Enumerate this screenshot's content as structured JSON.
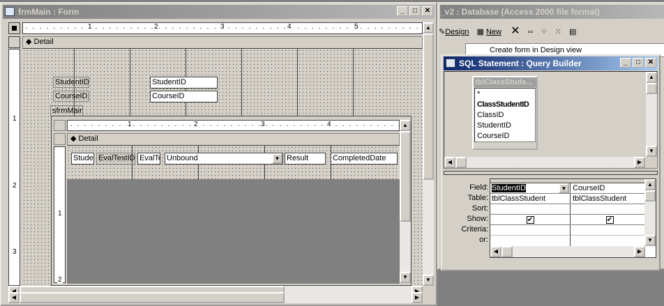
{
  "form_window": {
    "title": "frmMain : Form",
    "ruler": [
      "1",
      "2",
      "3",
      "4",
      "5"
    ],
    "detail_label": "Detail",
    "labels": {
      "student": "StudentID",
      "course": "CourseID:",
      "subform": "sfrmMain"
    },
    "textboxes": {
      "student": "StudentID",
      "course": "CourseID"
    },
    "vruler": [
      "1",
      "2",
      "3"
    ],
    "subform": {
      "ruler": [
        "1",
        "2",
        "3",
        "4"
      ],
      "detail_label": "Detail",
      "vruler": [
        "1",
        "2"
      ],
      "controls": {
        "stude": "Stude",
        "evaltestid": "EvalTestID",
        "evalte": "EvalTe",
        "combo": "Unbound",
        "result": "Result",
        "completed": "CompletedDate"
      }
    }
  },
  "db_window": {
    "title": "_v2 : Database (Access 2000 file format)",
    "toolbar": {
      "design": "Design",
      "new": "New"
    },
    "list_item": "Create form in Design view"
  },
  "query_builder": {
    "title": "SQL Statement : Query Builder",
    "table": {
      "name": "tblClassStude...",
      "fields": [
        "*",
        "ClassStudentID",
        "ClassID",
        "StudentID",
        "CourseID"
      ]
    },
    "row_labels": [
      "Field:",
      "Table:",
      "Sort:",
      "Show:",
      "Criteria:",
      "or:"
    ],
    "columns": [
      {
        "field": "StudentID",
        "table": "tblClassStudent",
        "show": true
      },
      {
        "field": "CourseID",
        "table": "tblClassStudent",
        "show": true
      }
    ]
  },
  "buttons": {
    "min": "_",
    "max": "□",
    "close": "✕",
    "check": "✔",
    "up": "▲",
    "down": "▼",
    "left": "◀",
    "right": "▶"
  }
}
